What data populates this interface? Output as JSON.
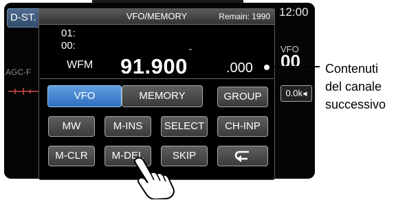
{
  "background": {
    "dstar_label": "D-ST.",
    "agc_label": "AGC-F",
    "clock": "12:00",
    "vfo_label": "VFO",
    "big_digits": "00",
    "step_label": "0.0k◂"
  },
  "dialog": {
    "title": "VFO/MEMORY",
    "remain": "Remain: 1990",
    "line1": "01:",
    "line2": "00:",
    "mode": "WFM",
    "frequency_main": "91.900",
    "frequency_small": ".000",
    "frequency_caret": "ˇ"
  },
  "buttons": {
    "vfo": "VFO",
    "memory": "MEMORY",
    "group": "GROUP",
    "mw": "MW",
    "m_ins": "M-INS",
    "select": "SELECT",
    "ch_inp": "CH-INP",
    "m_clr": "M-CLR",
    "m_del": "M-DEL",
    "skip": "SKIP",
    "back": "⮌"
  },
  "callout": {
    "line1": "Contenuti",
    "line2": "del canale",
    "line3": "successivo"
  },
  "colors": {
    "active_button": "#3f86d8",
    "button": "#4a4a4a",
    "screen": "#000000"
  },
  "state": {
    "active_tab": "VFO"
  }
}
